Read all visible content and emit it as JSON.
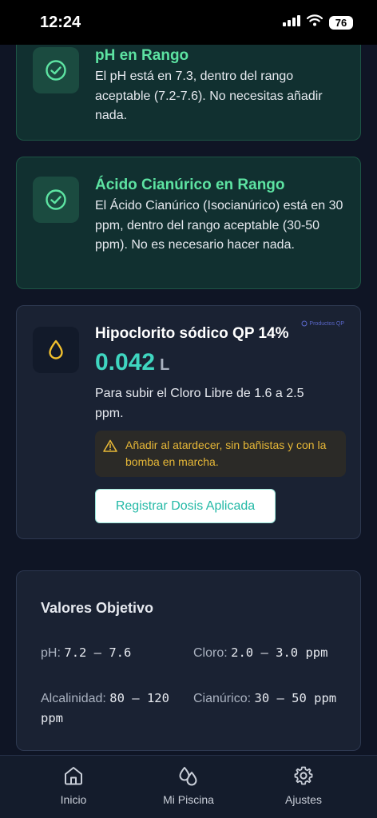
{
  "status_bar": {
    "time": "12:24",
    "battery": "76"
  },
  "cards": [
    {
      "title": "pH en Rango",
      "text": "El pH está en 7.3, dentro del rango aceptable (7.2-7.6). No necesitas añadir nada."
    },
    {
      "title": "Ácido Cianúrico en Rango",
      "text": "El Ácido Cianúrico (Isocianúrico) está en 30 ppm, dentro del rango aceptable (30-50 ppm). No es necesario hacer nada."
    }
  ],
  "dose": {
    "product": "Hipoclorito sódico QP 14%",
    "badge": "Productos QP",
    "amount": "0.042",
    "unit": "L",
    "description": "Para subir el Cloro Libre de 1.6 a 2.5 ppm.",
    "warning": "Añadir al atardecer, sin bañistas y con la bomba en marcha.",
    "button_label": "Registrar Dosis Aplicada"
  },
  "targets": {
    "title": "Valores Objetivo",
    "items": [
      {
        "label": "pH:",
        "value": "7.2 – 7.6"
      },
      {
        "label": "Cloro:",
        "value": "2.0 – 3.0 ppm"
      },
      {
        "label": "Alcalinidad:",
        "value": "80 – 120 ppm"
      },
      {
        "label": "Cianúrico:",
        "value": "30 – 50 ppm"
      }
    ]
  },
  "nav": [
    {
      "label": "Inicio",
      "icon": "home-icon"
    },
    {
      "label": "Mi Piscina",
      "icon": "drops-icon"
    },
    {
      "label": "Ajustes",
      "icon": "gear-icon"
    }
  ],
  "colors": {
    "ok_green": "#5de3a2",
    "dose_teal": "#3fd6c0",
    "warning_amber": "#e6b737",
    "drop_yellow": "#f2c12e"
  }
}
